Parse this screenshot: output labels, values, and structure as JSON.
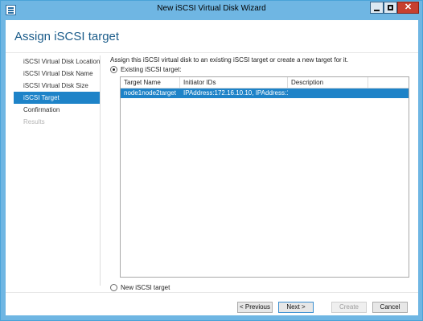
{
  "window": {
    "title": "New iSCSI Virtual Disk Wizard",
    "close_glyph": "✕"
  },
  "page": {
    "heading": "Assign iSCSI target"
  },
  "nav": {
    "items": [
      {
        "label": "iSCSI Virtual Disk Location",
        "state": "normal"
      },
      {
        "label": "iSCSI Virtual Disk Name",
        "state": "normal"
      },
      {
        "label": "iSCSI Virtual Disk Size",
        "state": "normal"
      },
      {
        "label": "iSCSI Target",
        "state": "active"
      },
      {
        "label": "Confirmation",
        "state": "normal"
      },
      {
        "label": "Results",
        "state": "disabled"
      }
    ]
  },
  "main": {
    "description": "Assign this iSCSI virtual disk to an existing iSCSI target or create a new target for it.",
    "existing_label": "Existing iSCSI target:",
    "new_label": "New iSCSI target",
    "selected_option": "existing",
    "table": {
      "columns": [
        "Target Name",
        "Initiator IDs",
        "Description"
      ],
      "rows": [
        {
          "target_name": "node1node2target",
          "initiator_ids": "IPAddress:172.16.10.10, IPAddress:1...",
          "description": ""
        }
      ]
    }
  },
  "buttons": {
    "previous": "< Previous",
    "next": "Next >",
    "create": "Create",
    "cancel": "Cancel"
  },
  "colors": {
    "accent": "#1e83c8",
    "titlebar": "#6fb6e3",
    "heading": "#1b5c8a"
  }
}
